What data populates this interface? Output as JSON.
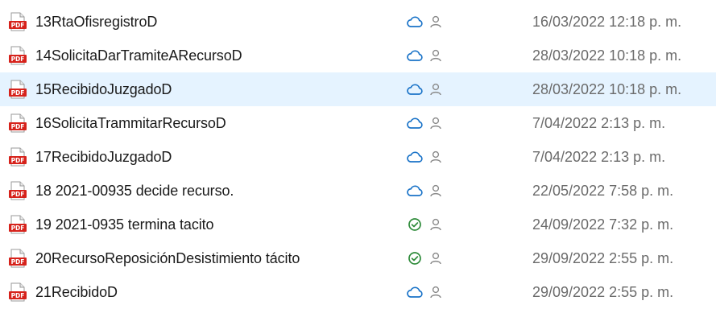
{
  "colors": {
    "pdf_red": "#d6221b",
    "cloud_blue": "#1a73c8",
    "synced_green": "#2e8b3a",
    "selection": "#e5f3ff"
  },
  "icons": {
    "file": "pdf-icon",
    "cloud_status": "cloud-outline-icon",
    "local_status": "check-circle-icon",
    "sharing": "person-icon"
  },
  "files": [
    {
      "name": "13RtaOfisregistroD",
      "status": "cloud",
      "modified": "16/03/2022 12:18 p. m.",
      "selected": false
    },
    {
      "name": "14SolicitaDarTramiteARecursoD",
      "status": "cloud",
      "modified": "28/03/2022 10:18 p. m.",
      "selected": false
    },
    {
      "name": "15RecibidoJuzgadoD",
      "status": "cloud",
      "modified": "28/03/2022 10:18 p. m.",
      "selected": true
    },
    {
      "name": "16SolicitaTrammitarRecursoD",
      "status": "cloud",
      "modified": "7/04/2022 2:13 p. m.",
      "selected": false
    },
    {
      "name": "17RecibidoJuzgadoD",
      "status": "cloud",
      "modified": "7/04/2022 2:13 p. m.",
      "selected": false
    },
    {
      "name": "18 2021-00935 decide recurso.",
      "status": "cloud",
      "modified": "22/05/2022 7:58 p. m.",
      "selected": false
    },
    {
      "name": "19 2021-0935 termina tacito",
      "status": "synced",
      "modified": "24/09/2022 7:32 p. m.",
      "selected": false
    },
    {
      "name": "20RecursoReposiciónDesistimiento tácito",
      "status": "synced",
      "modified": "29/09/2022 2:55 p. m.",
      "selected": false
    },
    {
      "name": "21RecibidoD",
      "status": "cloud",
      "modified": "29/09/2022 2:55 p. m.",
      "selected": false
    }
  ]
}
